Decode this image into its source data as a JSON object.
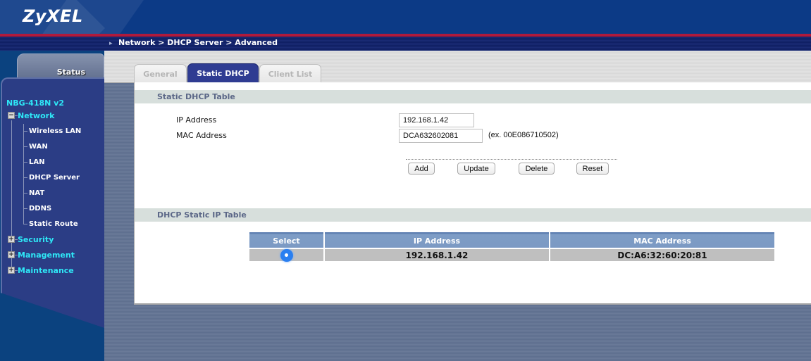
{
  "header": {
    "logo": "ZyXEL",
    "breadcrumb": "Network > DHCP Server > Advanced",
    "breadcrumb_icon": "arrow-bullet-icon"
  },
  "sidebar": {
    "status_label": "Status",
    "model": "NBG-418N v2",
    "groups": [
      {
        "label": "Network",
        "expanded": true,
        "icon": "minus-box-icon",
        "items": [
          {
            "label": "Wireless LAN"
          },
          {
            "label": "WAN"
          },
          {
            "label": "LAN"
          },
          {
            "label": "DHCP Server"
          },
          {
            "label": "NAT"
          },
          {
            "label": "DDNS"
          },
          {
            "label": "Static Route"
          }
        ]
      },
      {
        "label": "Security",
        "expanded": false,
        "icon": "plus-box-icon"
      },
      {
        "label": "Management",
        "expanded": false,
        "icon": "plus-box-icon"
      },
      {
        "label": "Maintenance",
        "expanded": false,
        "icon": "plus-box-icon"
      }
    ]
  },
  "tabs": [
    {
      "label": "General",
      "active": false
    },
    {
      "label": "Static DHCP",
      "active": true
    },
    {
      "label": "Client List",
      "active": false
    }
  ],
  "static_dhcp_table": {
    "title": "Static DHCP Table",
    "ip_label": "IP Address",
    "ip_value": "192.168.1.42",
    "mac_label": "MAC Address",
    "mac_value": "DCA632602081",
    "mac_example": "(ex. 00E086710502)",
    "buttons": {
      "add": "Add",
      "update": "Update",
      "delete": "Delete",
      "reset": "Reset"
    }
  },
  "static_ip_table": {
    "title": "DHCP Static IP Table",
    "columns": [
      "Select",
      "IP Address",
      "MAC Address"
    ],
    "rows": [
      {
        "selected": true,
        "ip": "192.168.1.42",
        "mac": "DC:A6:32:60:20:81"
      }
    ]
  },
  "colors": {
    "header_blue": "#0c3a86",
    "accent_red": "#b01a3c",
    "nav_cyan": "#2ee8f7",
    "active_tab": "#2f3c92",
    "table_header": "#7b99c3"
  }
}
